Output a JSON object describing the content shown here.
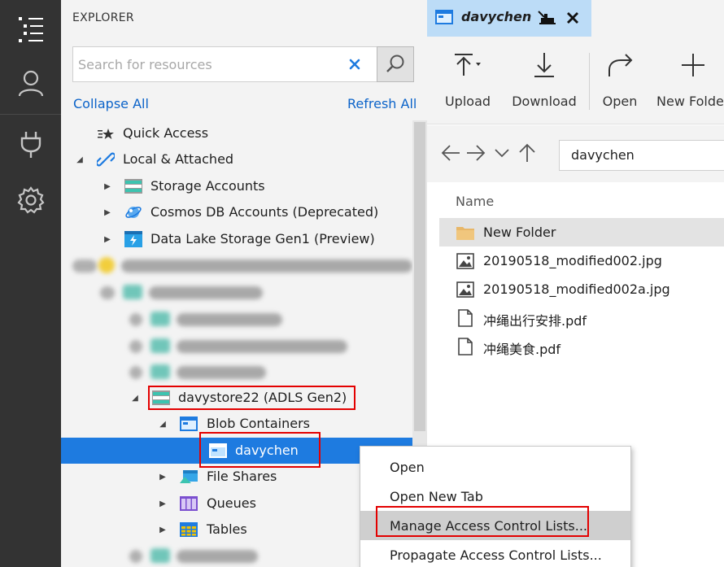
{
  "explorer": {
    "title": "EXPLORER",
    "search_placeholder": "Search for resources",
    "collapse_all": "Collapse All",
    "refresh_all": "Refresh All",
    "tree": {
      "quick_access": "Quick Access",
      "local_attached": "Local & Attached",
      "storage_accounts": "Storage Accounts",
      "cosmos": "Cosmos DB Accounts (Deprecated)",
      "datalake": "Data Lake Storage Gen1 (Preview)",
      "davystore": "davystore22 (ADLS Gen2)",
      "blob_containers": "Blob Containers",
      "davychen": "davychen",
      "file_shares": "File Shares",
      "queues": "Queues",
      "tables": "Tables"
    }
  },
  "tab": {
    "label": "davychen"
  },
  "toolbar": {
    "upload": "Upload",
    "download": "Download",
    "open": "Open",
    "new_folder": "New Folder"
  },
  "address": {
    "value": "davychen"
  },
  "list": {
    "header_name": "Name",
    "items": [
      {
        "name": "New Folder"
      },
      {
        "name": "20190518_modified002.jpg"
      },
      {
        "name": "20190518_modified002a.jpg"
      },
      {
        "name": "冲绳出行安排.pdf"
      },
      {
        "name": "冲绳美食.pdf"
      }
    ]
  },
  "context_menu": {
    "open": "Open",
    "open_new_tab": "Open New Tab",
    "manage_acl": "Manage Access Control Lists...",
    "propagate_acl": "Propagate Access Control Lists..."
  },
  "colors": {
    "activity_bar": "#333333",
    "selection": "#1e7be0",
    "tab_active": "#bcdcf7",
    "link": "#0b63c9",
    "highlight_box": "#e30000"
  }
}
